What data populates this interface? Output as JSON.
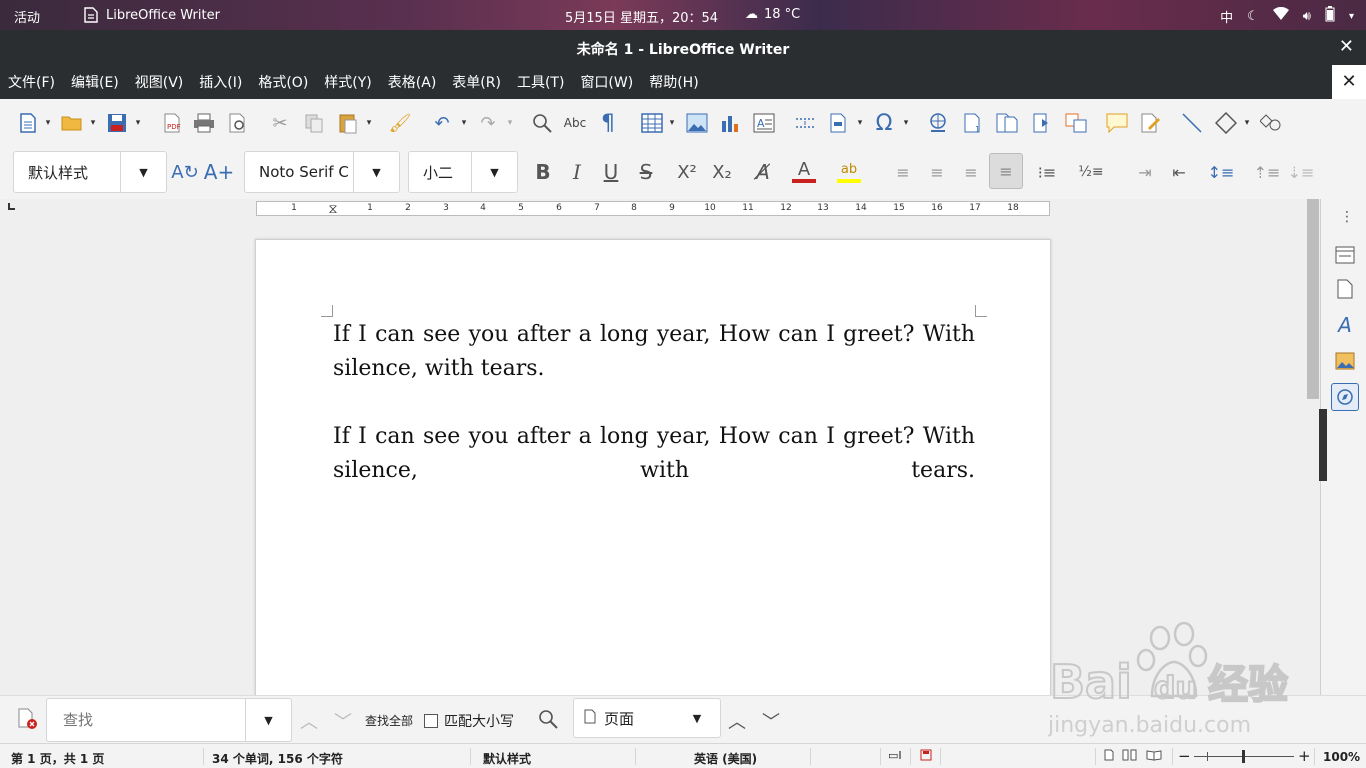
{
  "topbar": {
    "activities": "活动",
    "app_name": "LibreOffice Writer",
    "clock": "5月15日 星期五，20：54",
    "weather": "18 °C",
    "input_method": "中"
  },
  "window": {
    "title": "未命名 1 - LibreOffice Writer"
  },
  "menu": [
    "文件(F)",
    "编辑(E)",
    "视图(V)",
    "插入(I)",
    "格式(O)",
    "样式(Y)",
    "表格(A)",
    "表单(R)",
    "工具(T)",
    "窗口(W)",
    "帮助(H)"
  ],
  "formatting": {
    "paragraph_style": "默认样式",
    "font_name": "Noto Serif C",
    "font_size": "小二"
  },
  "ruler_ticks": [
    "1",
    "1",
    "2",
    "3",
    "4",
    "5",
    "6",
    "7",
    "8",
    "9",
    "10",
    "11",
    "12",
    "13",
    "14",
    "15",
    "16",
    "17",
    "18"
  ],
  "document": {
    "paragraph1": "If I can see you after a long year, How can I greet? With silence, with tears.",
    "paragraph2": "If I can see you after a long year, How can I greet? With silence, with tears."
  },
  "findbar": {
    "placeholder": "查找",
    "find_all": "查找全部",
    "match_case": "匹配大小写",
    "search_scope": "页面"
  },
  "statusbar": {
    "page_info": "第 1 页，共 1 页",
    "word_count": "34 个单词, 156 个字符",
    "page_style": "默认样式",
    "language": "英语 (美国)",
    "zoom": "100%"
  },
  "watermark": {
    "brand": "Baidu",
    "suffix": "经验",
    "url": "jingyan.baidu.com"
  },
  "colors": {
    "topbar": "#5a3050",
    "titlebar": "#2b2e31",
    "accent_blue": "#3b6db3",
    "font_color_red": "#c9211e",
    "highlight_yellow": "#ffff00"
  }
}
